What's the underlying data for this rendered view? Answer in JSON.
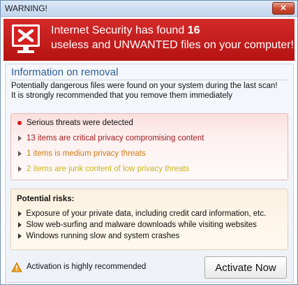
{
  "window": {
    "title": "WARNING!",
    "close_glyph": "✕"
  },
  "banner": {
    "line1_prefix": "Internet Security has found ",
    "count": "16",
    "line2": "useless and UNWANTED files on your computer!",
    "icon": "monitor-x-icon"
  },
  "info": {
    "heading": "Information on removal",
    "desc1": "Potentially dangerous files were found on your system during the last scan!",
    "desc2": "It is strongly recommended that you remove them immediately"
  },
  "threats": [
    {
      "label": "Serious threats were detected",
      "color": "#111111",
      "bullet": "dot"
    },
    {
      "label": "13 items are critical privacy compromising content",
      "color": "#a11a1a",
      "bullet": "triangle"
    },
    {
      "label": "1 items is medium privacy threats",
      "color": "#d07a14",
      "bullet": "triangle"
    },
    {
      "label": "2 items are junk content of low privacy threats",
      "color": "#c9b51a",
      "bullet": "triangle"
    }
  ],
  "risks": {
    "title": "Potential risks:",
    "items": [
      "Exposure of your private data, including credit card information, etc.",
      "Slow web-surfing and malware downloads while visiting websites",
      "Windows running slow and system crashes"
    ]
  },
  "footer": {
    "activation_text": "Activation is highly recommended",
    "activate_button": "Activate Now",
    "warn_icon": "warning-triangle-icon"
  }
}
